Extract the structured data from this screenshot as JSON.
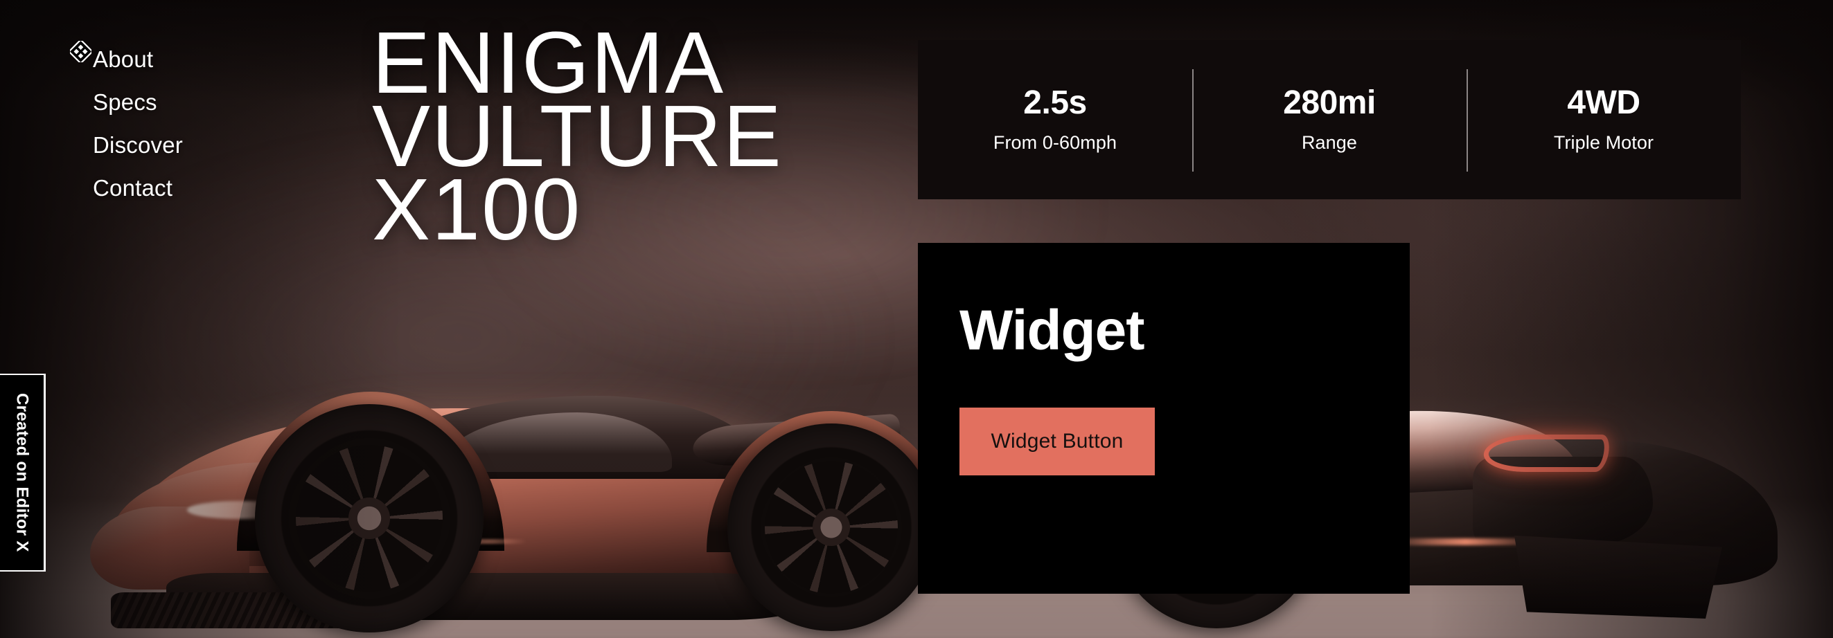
{
  "site": {
    "background_alt": "rose-gold supercar in dark smoky studio"
  },
  "nav": {
    "items": [
      {
        "label": "About"
      },
      {
        "label": "Specs"
      },
      {
        "label": "Discover"
      },
      {
        "label": "Contact"
      }
    ]
  },
  "hero": {
    "title": "ENIGMA\nVULTURE\nX100"
  },
  "stats": {
    "items": [
      {
        "value": "2.5s",
        "label": "From 0-60mph"
      },
      {
        "value": "280mi",
        "label": "Range"
      },
      {
        "value": "4WD",
        "label": "Triple Motor"
      }
    ]
  },
  "widget": {
    "title": "Widget",
    "button_label": "Widget Button"
  },
  "badge": {
    "text": "Created on Editor X"
  },
  "cursor": {
    "icon": "move-cursor-icon"
  },
  "colors": {
    "accent": "#e2705f",
    "panel_bg": "#000000",
    "stats_bg": "#100b0b",
    "text": "#ffffff",
    "page_bg": "#1d1615"
  }
}
